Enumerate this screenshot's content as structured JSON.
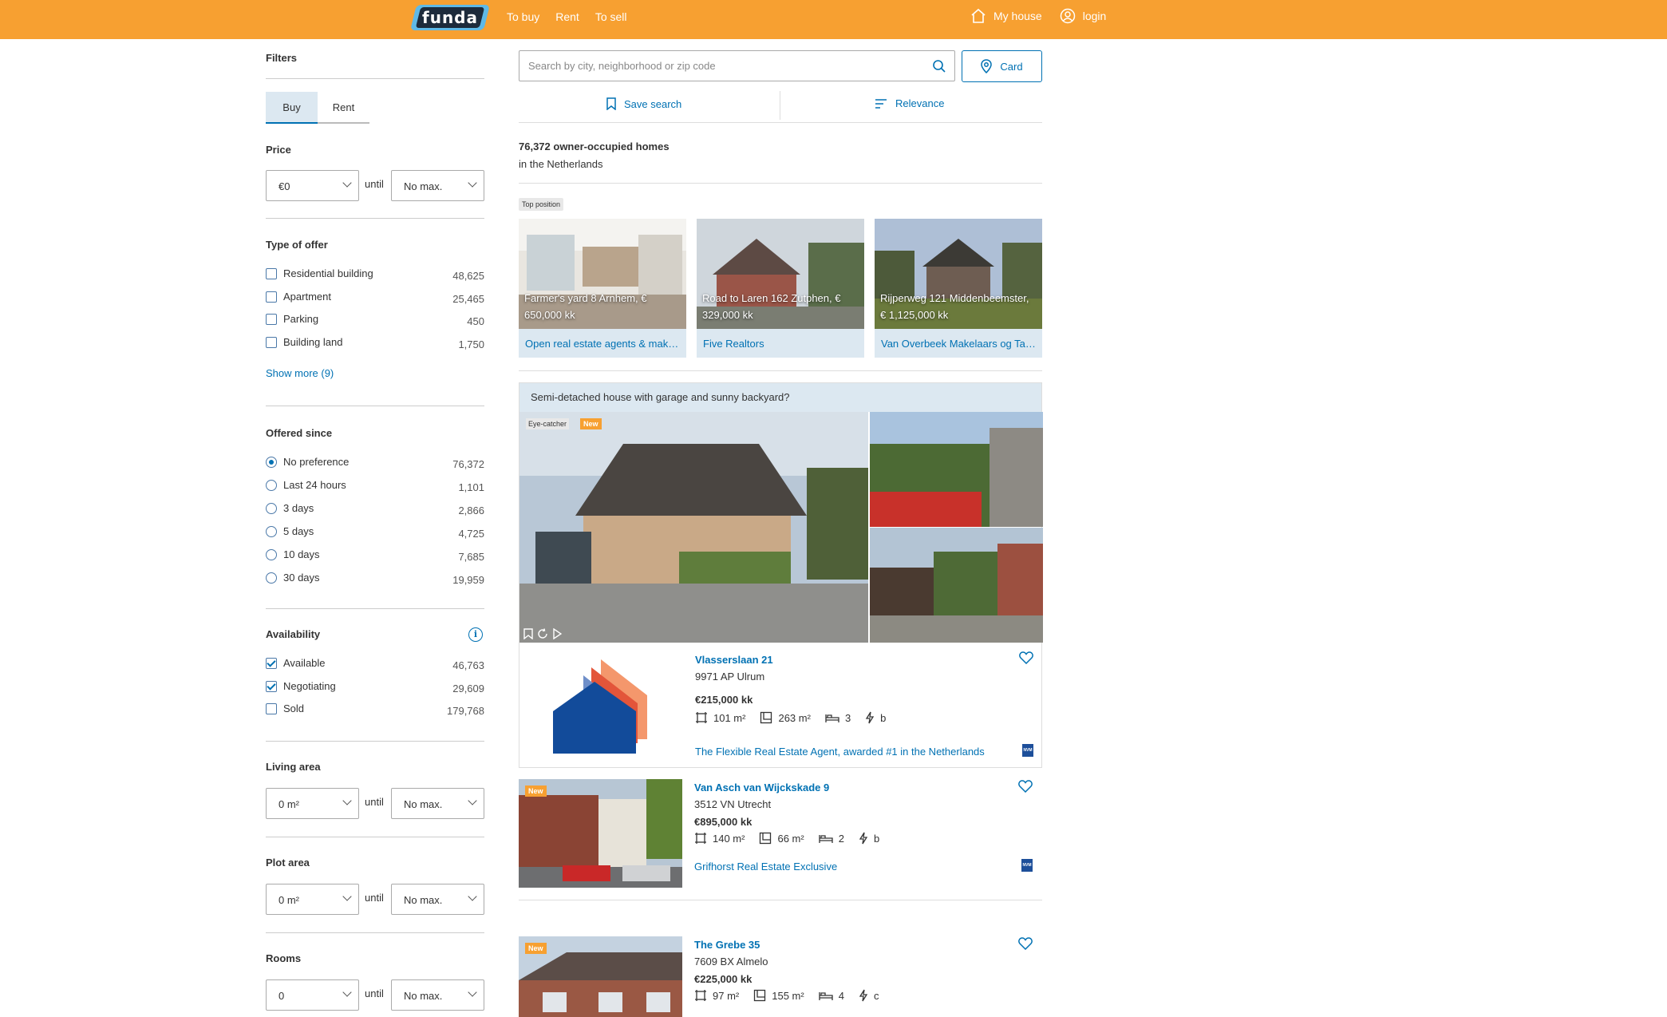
{
  "header": {
    "logo": "funda",
    "nav": [
      "To buy",
      "Rent",
      "To sell"
    ],
    "my_house": "My house",
    "login": "login"
  },
  "sidebar": {
    "title": "Filters",
    "tabs": [
      "Buy",
      "Rent"
    ],
    "price": {
      "title": "Price",
      "min": "€0",
      "until": "until",
      "max": "No max."
    },
    "type_of_offer": {
      "title": "Type of offer",
      "items": [
        {
          "label": "Residential building",
          "count": "48,625",
          "checked": false
        },
        {
          "label": "Apartment",
          "count": "25,465",
          "checked": false
        },
        {
          "label": "Parking",
          "count": "450",
          "checked": false
        },
        {
          "label": "Building land",
          "count": "1,750",
          "checked": false
        }
      ],
      "show_more": "Show more (9)"
    },
    "offered_since": {
      "title": "Offered since",
      "items": [
        {
          "label": "No preference",
          "count": "76,372",
          "checked": true
        },
        {
          "label": "Last 24 hours",
          "count": "1,101",
          "checked": false
        },
        {
          "label": "3 days",
          "count": "2,866",
          "checked": false
        },
        {
          "label": "5 days",
          "count": "4,725",
          "checked": false
        },
        {
          "label": "10 days",
          "count": "7,685",
          "checked": false
        },
        {
          "label": "30 days",
          "count": "19,959",
          "checked": false
        }
      ]
    },
    "availability": {
      "title": "Availability",
      "items": [
        {
          "label": "Available",
          "count": "46,763",
          "checked": true
        },
        {
          "label": "Negotiating",
          "count": "29,609",
          "checked": true
        },
        {
          "label": "Sold",
          "count": "179,768",
          "checked": false
        }
      ]
    },
    "living_area": {
      "title": "Living area",
      "min": "0 m²",
      "until": "until",
      "max": "No max."
    },
    "plot_area": {
      "title": "Plot area",
      "min": "0 m²",
      "until": "until",
      "max": "No max."
    },
    "rooms": {
      "title": "Rooms",
      "min": "0",
      "until": "until",
      "max": "No max."
    }
  },
  "search": {
    "placeholder": "Search by city, neighborhood or zip code",
    "card_button": "Card",
    "save_search": "Save search",
    "relevance": "Relevance"
  },
  "results": {
    "count_text": "76,372 owner-occupied homes",
    "location": "in the Netherlands"
  },
  "top_position": {
    "badge": "Top position",
    "cards": [
      {
        "caption": "Farmer's yard 8 Arnhem, € 650,000 kk",
        "agent": "Open real estate agents & makelaars"
      },
      {
        "caption": "Road to Laren 162 Zutphen, € 329,000 kk",
        "agent": "Five Realtors"
      },
      {
        "caption": "Rijperweg 121 Middenbeemster, € 1,125,000 kk",
        "agent": "Van Overbeek Makelaars og Taxateurs"
      }
    ]
  },
  "featured": {
    "banner": "Semi-detached house with garage and sunny backyard?",
    "badge_eye": "Eye-catcher",
    "badge_new": "New",
    "title": "Vlasserslaan 21",
    "address": "9971 AP Ulrum",
    "price": "€215,000 kk",
    "living": "101 m²",
    "plot": "263 m²",
    "rooms": "3",
    "energy": "b",
    "agent": "The Flexible Real Estate Agent, awarded #1 in the Netherlands",
    "nvm": "NVM"
  },
  "listings": [
    {
      "badge": "New",
      "title": "Van Asch van Wijckskade 9",
      "address": "3512 VN Utrecht",
      "price": "€895,000 kk",
      "living": "140 m²",
      "plot": "66 m²",
      "rooms": "2",
      "energy": "b",
      "agent": "Grifhorst Real Estate Exclusive",
      "nvm": "NVM"
    },
    {
      "badge": "New",
      "title": "The Grebe 35",
      "address": "7609 BX Almelo",
      "price": "€225,000 kk",
      "living": "97 m²",
      "plot": "155 m²",
      "rooms": "4",
      "energy": "c"
    }
  ],
  "colors": {
    "brand_orange": "#f7a031",
    "link_blue": "#0071b3",
    "highlight_bg": "#dce8f1"
  }
}
